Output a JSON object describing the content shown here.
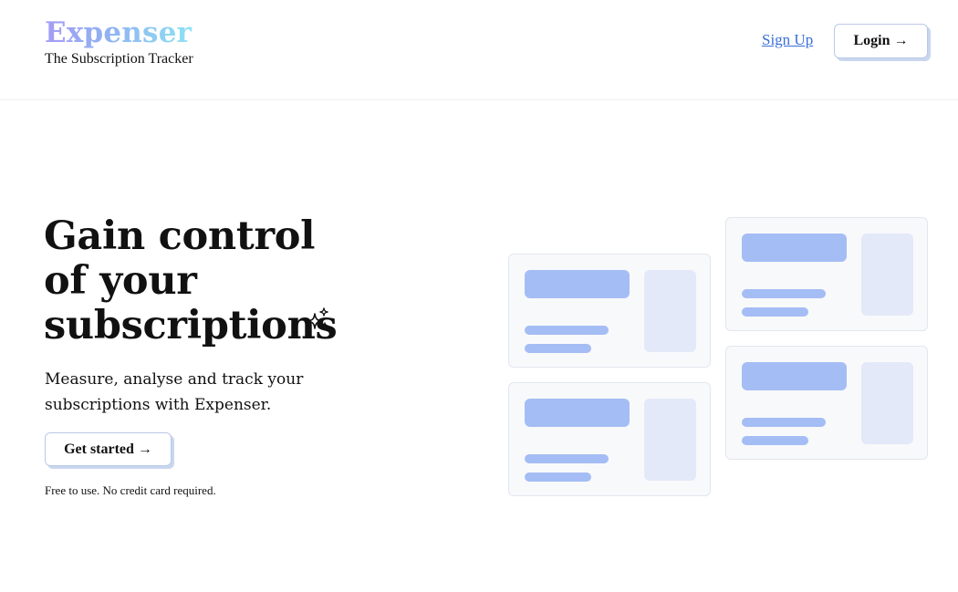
{
  "brand": {
    "name": "Expenser",
    "tagline": "The Subscription Tracker"
  },
  "nav": {
    "signup_label": "Sign Up",
    "login_label": "Login",
    "login_arrow": "→"
  },
  "hero": {
    "title_lines": [
      "Gain control",
      "of your",
      "subscriptions"
    ],
    "subtitle": "Measure, analyse and track your subscriptions with Expenser.",
    "cta_label": "Get started",
    "cta_arrow": "→",
    "fine_print": "Free to use. No credit card required."
  },
  "icons": {
    "sparkle": "sparkle-icon"
  },
  "colors": {
    "accent": "#a4bdf4",
    "accent_light": "#e3e9f8",
    "link": "#3a6fd8",
    "brand_gradient": [
      "#a39cf4",
      "#8fb4f2",
      "#8fe3f3"
    ]
  }
}
